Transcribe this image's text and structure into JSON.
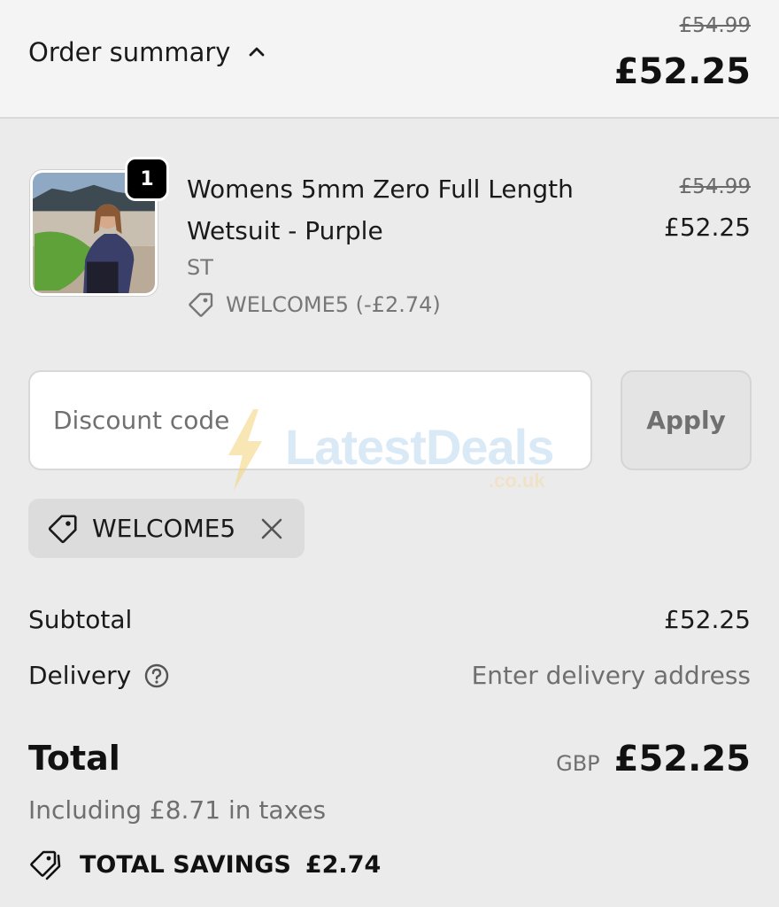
{
  "header": {
    "toggle_label": "Order summary",
    "original_price": "£54.99",
    "price": "£52.25"
  },
  "item": {
    "quantity": "1",
    "name": "Womens 5mm Zero Full Length Wetsuit - Purple",
    "variant": "ST",
    "discount_label": "WELCOME5 (-£2.74)",
    "original_price": "£54.99",
    "price": "£52.25"
  },
  "discount": {
    "placeholder": "Discount code",
    "apply_label": "Apply",
    "applied_code": "WELCOME5"
  },
  "watermark": {
    "brand": "LatestDeals",
    "domain": ".co.uk"
  },
  "summary": {
    "subtotal_label": "Subtotal",
    "subtotal_value": "£52.25",
    "delivery_label": "Delivery",
    "delivery_value": "Enter delivery address",
    "total_label": "Total",
    "currency": "GBP",
    "total_value": "£52.25",
    "tax_note": "Including £8.71 in taxes",
    "savings_label": "TOTAL SAVINGS",
    "savings_value": "£2.74"
  },
  "colors": {
    "background": "#ebebeb",
    "header_bg": "#f4f4f4",
    "text": "#1a1a1a",
    "muted": "#707070",
    "chip_bg": "#dcdcdc"
  },
  "icons": [
    "chevron-up-icon",
    "tag-icon",
    "close-icon",
    "help-circle-icon",
    "tags-icon"
  ]
}
